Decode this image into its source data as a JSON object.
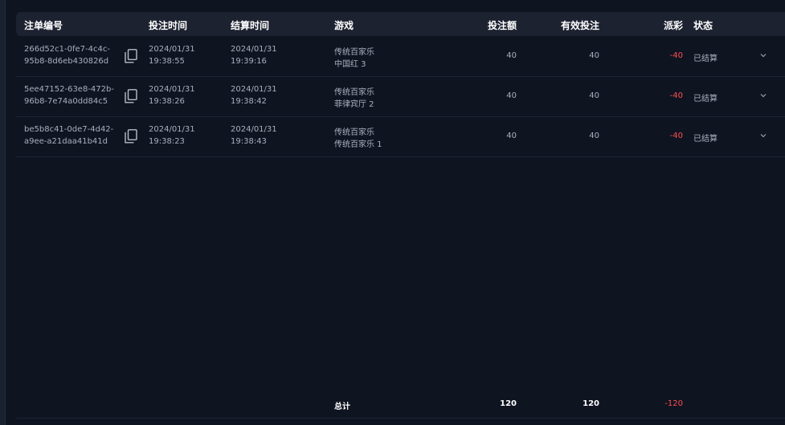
{
  "columns": {
    "order_id": "注单编号",
    "bet_time": "投注时间",
    "settle_time": "结算时间",
    "game": "游戏",
    "bet_amount": "投注额",
    "valid_bet": "有效投注",
    "payout": "派彩",
    "status": "状态"
  },
  "rows": [
    {
      "order_id_1": "266d52c1-0fe7-4c4c-",
      "order_id_2": "95b8-8d6eb430826d",
      "bet_date": "2024/01/31",
      "bet_clock": "19:38:55",
      "settle_date": "2024/01/31",
      "settle_clock": "19:39:16",
      "game_1": "传统百家乐",
      "game_2": "中国红 3",
      "bet_amount": "40",
      "valid_bet": "40",
      "payout": "-40",
      "status": "已结算"
    },
    {
      "order_id_1": "5ee47152-63e8-472b-",
      "order_id_2": "96b8-7e74a0dd84c5",
      "bet_date": "2024/01/31",
      "bet_clock": "19:38:26",
      "settle_date": "2024/01/31",
      "settle_clock": "19:38:42",
      "game_1": "传统百家乐",
      "game_2": "菲律宾厅 2",
      "bet_amount": "40",
      "valid_bet": "40",
      "payout": "-40",
      "status": "已结算"
    },
    {
      "order_id_1": "be5b8c41-0de7-4d42-",
      "order_id_2": "a9ee-a21daa41b41d",
      "bet_date": "2024/01/31",
      "bet_clock": "19:38:23",
      "settle_date": "2024/01/31",
      "settle_clock": "19:38:43",
      "game_1": "传统百家乐",
      "game_2": "传统百家乐 1",
      "bet_amount": "40",
      "valid_bet": "40",
      "payout": "-40",
      "status": "已结算"
    }
  ],
  "totals": {
    "label": "总计",
    "bet_amount": "120",
    "valid_bet": "120",
    "payout": "-120"
  },
  "colors": {
    "background": "#0f1421",
    "header": "#1c2230",
    "negative": "#ff4d4f"
  },
  "icons": {
    "copy": "copy-icon",
    "expand": "chevron-down-icon"
  }
}
